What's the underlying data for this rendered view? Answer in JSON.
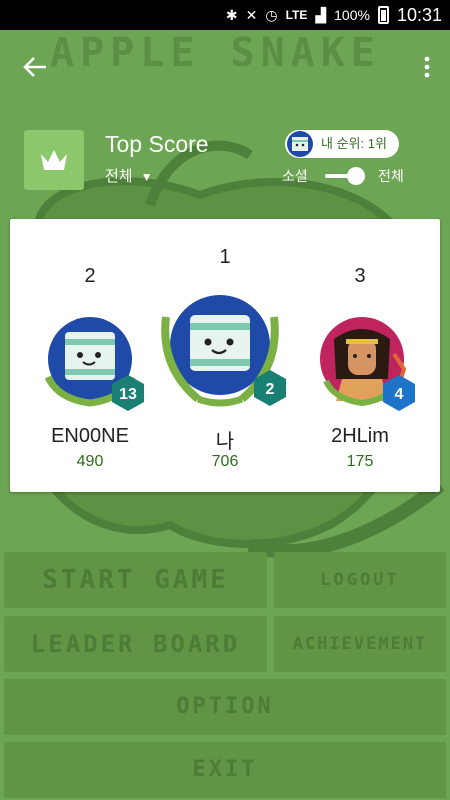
{
  "status": {
    "network": "LTE",
    "battery": "100%",
    "time": "10:31"
  },
  "background": {
    "title": "APPLE SNAKE"
  },
  "header": {
    "title": "Top Score",
    "scope_label": "전체"
  },
  "my_rank": "내 순위: 1위",
  "toggle": {
    "left_label": "소셜",
    "right_label": "전체"
  },
  "leaderboard": [
    {
      "rank": "2",
      "name": "EN00NE",
      "score": "490",
      "level": "13"
    },
    {
      "rank": "1",
      "name": "나",
      "score": "706",
      "level": "2"
    },
    {
      "rank": "3",
      "name": "2HLim",
      "score": "175",
      "level": "4"
    }
  ],
  "buttons": {
    "start": "START GAME",
    "logout": "LOGOUT",
    "leader": "LEADER BOARD",
    "achievement": "ACHIEVEMENT",
    "option": "OPTION",
    "exit": "EXIT"
  },
  "colors": {
    "accent_green": "#6ca553",
    "badge_teal": "#1a8073",
    "badge_blue": "#1c73c7"
  }
}
